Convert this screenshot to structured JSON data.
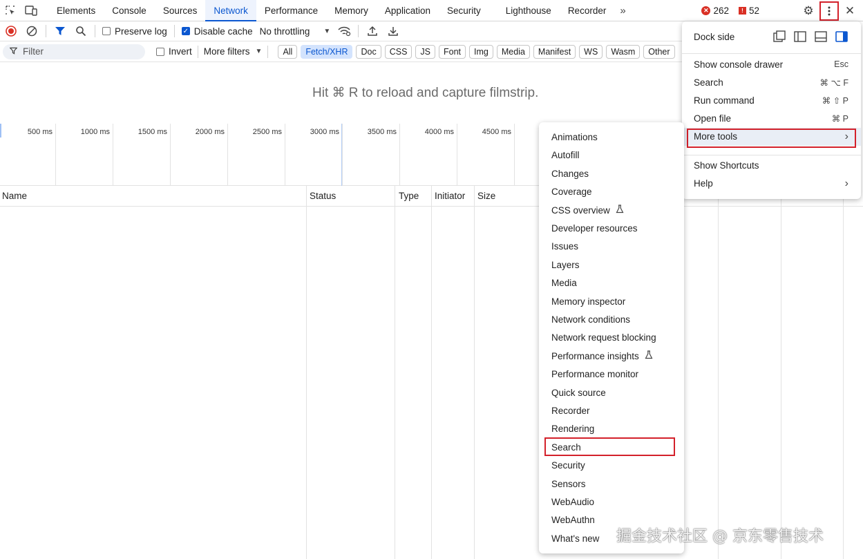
{
  "tabbar": {
    "tabs": [
      "Elements",
      "Console",
      "Sources",
      "Network",
      "Performance",
      "Memory",
      "Application",
      "Security",
      "Lighthouse",
      "Recorder"
    ],
    "active_tab": "Network",
    "more_tabs_glyph": "»",
    "error_count": "262",
    "warning_count": "52"
  },
  "toolbar": {
    "preserve_log_label": "Preserve log",
    "preserve_log_checked": false,
    "disable_cache_label": "Disable cache",
    "disable_cache_checked": true,
    "throttling_label": "No throttling"
  },
  "filterbar": {
    "filter_placeholder": "Filter",
    "invert_label": "Invert",
    "more_filters_label": "More filters",
    "type_filters": [
      "All",
      "Fetch/XHR",
      "Doc",
      "CSS",
      "JS",
      "Font",
      "Img",
      "Media",
      "Manifest",
      "WS",
      "Wasm",
      "Other"
    ],
    "active_type_filter": "Fetch/XHR"
  },
  "filmstrip_hint": "Hit ⌘ R to reload and capture filmstrip.",
  "timeline_ticks": [
    "500 ms",
    "1000 ms",
    "1500 ms",
    "2000 ms",
    "2500 ms",
    "3000 ms",
    "3500 ms",
    "4000 ms",
    "4500 ms"
  ],
  "table": {
    "columns": [
      "Name",
      "Status",
      "Type",
      "Initiator",
      "Size"
    ]
  },
  "main_menu": {
    "dock_side_label": "Dock side",
    "items": [
      {
        "label": "Show console drawer",
        "shortcut": "Esc"
      },
      {
        "label": "Search",
        "shortcut": "⌘ ⌥ F"
      },
      {
        "label": "Run command",
        "shortcut": "⌘ ⇧ P"
      },
      {
        "label": "Open file",
        "shortcut": "⌘ P"
      },
      {
        "label": "More tools",
        "shortcut": "›"
      }
    ],
    "items2": [
      {
        "label": "Show Shortcuts",
        "shortcut": ""
      },
      {
        "label": "Help",
        "shortcut": "›"
      }
    ]
  },
  "more_tools_menu": {
    "items": [
      "Animations",
      "Autofill",
      "Changes",
      "Coverage",
      "CSS overview",
      "Developer resources",
      "Issues",
      "Layers",
      "Media",
      "Memory inspector",
      "Network conditions",
      "Network request blocking",
      "Performance insights",
      "Performance monitor",
      "Quick source",
      "Recorder",
      "Rendering",
      "Search",
      "Security",
      "Sensors",
      "WebAudio",
      "WebAuthn",
      "What's new"
    ],
    "experimental_items": [
      "CSS overview",
      "Performance insights"
    ],
    "highlighted_item": "Search"
  },
  "watermark": "掘金技术社区 @ 京东零售技术",
  "colors": {
    "accent": "#0b57d0",
    "highlight_box": "#d3202a",
    "error": "#d93025"
  }
}
